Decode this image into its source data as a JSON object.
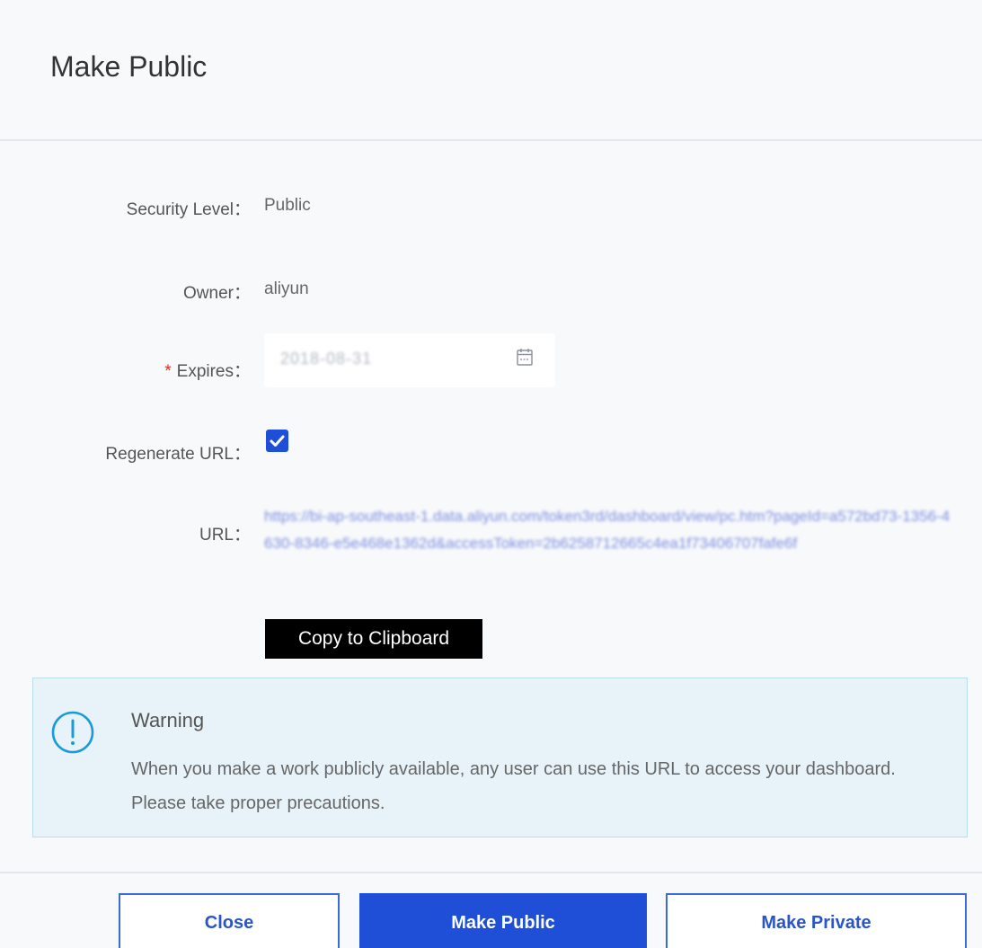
{
  "dialog": {
    "title": "Make Public"
  },
  "form": {
    "security_level": {
      "label": "Security Level：",
      "value": "Public"
    },
    "owner": {
      "label": "Owner：",
      "value": "aliyun"
    },
    "expires": {
      "required_mark": "*",
      "label": "Expires：",
      "value": "2018-08-31",
      "icon": "calendar-icon"
    },
    "regenerate_url": {
      "label": "Regenerate URL：",
      "checked": true,
      "icon": "checkmark-icon"
    },
    "url": {
      "label": "URL：",
      "value": "https://bi-ap-southeast-1.data.aliyun.com/token3rd/dashboard/view/pc.htm?pageId=a572bd73-1356-4630-8346-e5e468e1362d&accessToken=2b6258712665c4ea1f73406707fafe6f"
    },
    "copy_button": "Copy to Clipboard"
  },
  "warning": {
    "icon": "exclamation-circle-icon",
    "title": "Warning",
    "body": "When you make a work publicly available, any user can use this URL to access your dashboard. Please take proper precautions."
  },
  "footer": {
    "close_label": "Close",
    "make_public_label": "Make Public",
    "make_private_label": "Make Private"
  },
  "colors": {
    "primary": "#1f4fd6",
    "required": "#e0301e",
    "warning_bg": "#e7f3f8",
    "warning_icon": "#1a9bd7"
  }
}
